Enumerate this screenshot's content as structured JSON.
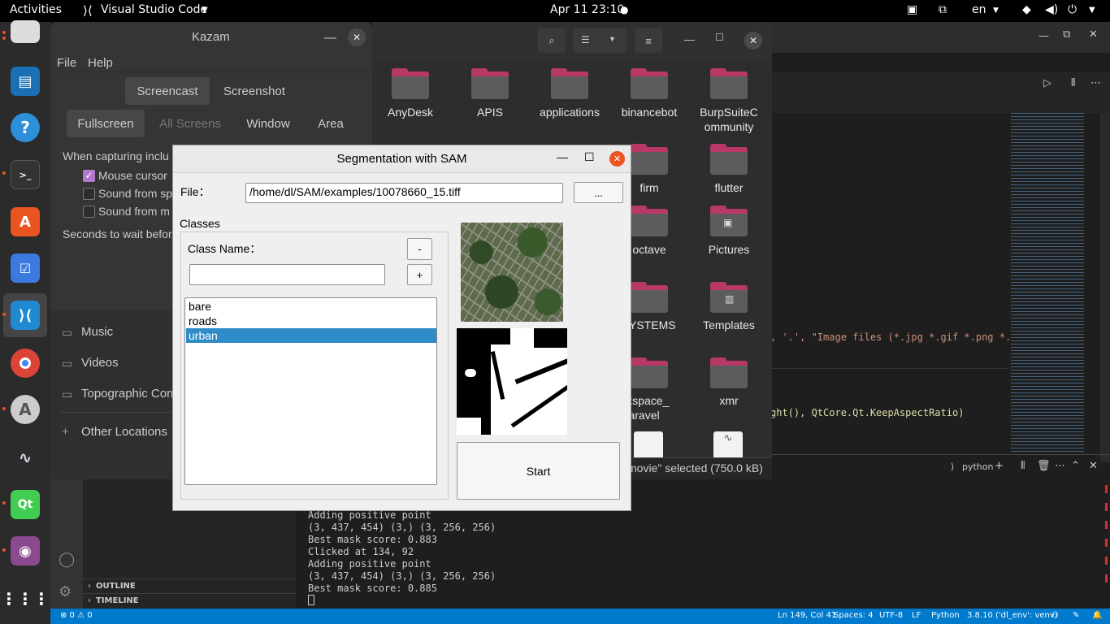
{
  "topbar": {
    "activities": "Activities",
    "app_name": "Visual Studio Code",
    "clock": "Apr 11  23:10",
    "lang": "en"
  },
  "dock": {
    "icons": [
      "files-icon",
      "writer-icon",
      "help-icon",
      "terminal-icon",
      "software-store-icon",
      "tasks-icon",
      "vscode-icon",
      "chrome-icon",
      "updater-icon",
      "system-monitor-icon",
      "qt-creator-icon",
      "kazam-icon",
      "app-grid-icon"
    ]
  },
  "kazam": {
    "title": "Kazam",
    "menu": [
      "File",
      "Help"
    ],
    "modes": {
      "screencast": "Screencast",
      "screenshot": "Screenshot"
    },
    "areas": {
      "fullscreen": "Fullscreen",
      "all": "All Screens",
      "window": "Window",
      "area": "Area"
    },
    "capturing": "When capturing inclu",
    "options": [
      {
        "label": "Mouse cursor",
        "checked": true
      },
      {
        "label": "Sound from sp",
        "checked": false
      },
      {
        "label": "Sound from m",
        "checked": false
      }
    ],
    "wait": "Seconds to wait befor"
  },
  "files": {
    "folders_row1": [
      "AnyDesk",
      "APIS",
      "applications",
      "binancebot",
      "BurpSuiteC\nommunity"
    ],
    "folders_col": [
      "firm",
      "octave",
      "YSTEMS",
      "orkspace_\nlaravel"
    ],
    "folders_right": [
      "flutter",
      "Pictures",
      "Templates",
      "xmr"
    ],
    "status": "movie\" selected  (750.0 kB)"
  },
  "sidebar": {
    "items": [
      "Music",
      "Videos",
      "Topographic Corr"
    ],
    "other": "Other Locations"
  },
  "sam": {
    "title": "Segmentation with SAM",
    "file_label": "File：",
    "file_path": "/home/dl/SAM/examples/10078660_15.tiff",
    "browse": "...",
    "classes_label": "Classes",
    "class_name_label": "Class Name：",
    "class_name_value": "",
    "minus": "-",
    "plus": "+",
    "classes": [
      {
        "name": "bare",
        "selected": false
      },
      {
        "name": "roads",
        "selected": false
      },
      {
        "name": "urban",
        "selected": true
      }
    ],
    "start": "Start"
  },
  "vscode": {
    "code_fragment_1": ", '.', \"Image files (*.jpg *.gif *.png *.",
    "code_fragment_2": "ght(), QtCore.Qt.KeepAspectRatio)",
    "terminal_kind": "python",
    "terminal_lines": [
      "Adding positive point",
      "(3, 437, 454) (3,) (3, 256, 256)",
      "Best mask score: 0.883",
      "Clicked at 134, 92",
      "Adding positive point",
      "(3, 437, 454) (3,) (3, 256, 256)",
      "Best mask score: 0.885"
    ],
    "outline": "OUTLINE",
    "timeline": "TIMELINE"
  },
  "status": {
    "errors": "⊗ 0 ⚠ 0",
    "position": "Ln 149, Col 41",
    "spaces": "Spaces: 4",
    "encoding": "UTF-8",
    "eol": "LF",
    "language": "Python",
    "interpreter": "3.8.10 ('dl_env': venv)"
  },
  "colors": {
    "selection": "#308cc6",
    "statusbar": "#007acc",
    "close": "#e95420",
    "folder_accent": "#b83868"
  }
}
